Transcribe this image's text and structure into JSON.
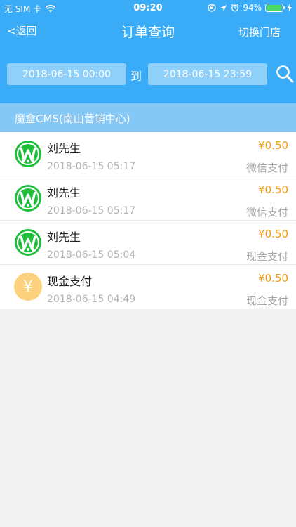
{
  "status_bar": {
    "carrier": "无 SIM 卡",
    "time": "09:20",
    "battery": "94%",
    "battery_level": 0.94
  },
  "nav": {
    "back_label": "<返回",
    "title": "订单查询",
    "switch_label": "切换门店"
  },
  "filter": {
    "start": "2018-06-15 00:00",
    "separator": "到",
    "end": "2018-06-15 23:59"
  },
  "store": {
    "name": "魔盒CMS(南山营销中心)"
  },
  "orders": [
    {
      "name": "刘先生",
      "time": "2018-06-15 05:17",
      "amount": "¥0.50",
      "method": "微信支付",
      "icon": "wechat-pay-icon"
    },
    {
      "name": "刘先生",
      "time": "2018-06-15 05:17",
      "amount": "¥0.50",
      "method": "微信支付",
      "icon": "wechat-pay-icon"
    },
    {
      "name": "刘先生",
      "time": "2018-06-15 05:04",
      "amount": "¥0.50",
      "method": "现金支付",
      "icon": "wechat-pay-icon"
    },
    {
      "name": "现金支付",
      "time": "2018-06-15 04:49",
      "amount": "¥0.50",
      "method": "现金支付",
      "icon": "cash-icon",
      "icon_glyph": "¥"
    }
  ],
  "colors": {
    "header": "#3aacf7",
    "store_bar": "#86c8f5",
    "amount": "#f39c12",
    "wechat_green": "#1dbf3a",
    "cash_yellow": "#fcd27f"
  }
}
